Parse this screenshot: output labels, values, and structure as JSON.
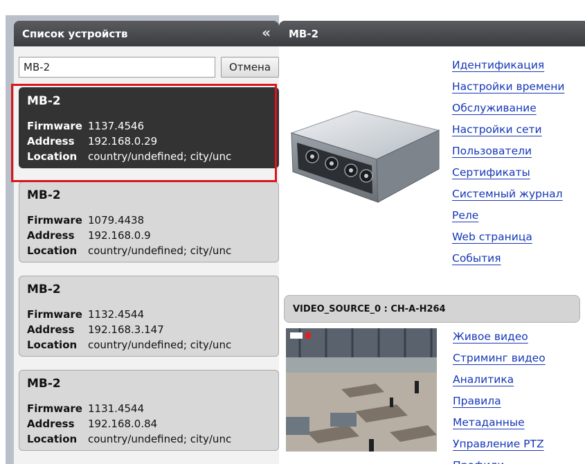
{
  "device_list": {
    "title": "Список устройств",
    "collapse_icon": "double-chevron-left-icon",
    "search": {
      "value": "MB-2",
      "placeholder": ""
    },
    "cancel_label": "Отмена",
    "field_labels": {
      "firmware": "Firmware",
      "address": "Address",
      "location": "Location"
    },
    "devices": [
      {
        "name": "MB-2",
        "firmware": "1137.4546",
        "address": "192.168.0.29",
        "location": "country/undefined; city/unc",
        "selected": true
      },
      {
        "name": "MB-2",
        "firmware": "1079.4438",
        "address": "192.168.0.9",
        "location": "country/undefined; city/unc",
        "selected": false
      },
      {
        "name": "MB-2",
        "firmware": "1132.4544",
        "address": "192.168.3.147",
        "location": "country/undefined; city/unc",
        "selected": false
      },
      {
        "name": "MB-2",
        "firmware": "1131.4544",
        "address": "192.168.0.84",
        "location": "country/undefined; city/unc",
        "selected": false
      }
    ]
  },
  "device_panel": {
    "title": "MB-2",
    "menu": [
      "Идентификация",
      "Настройки времени",
      "Обслуживание",
      "Настройки сети",
      "Пользователи",
      "Сертификаты",
      "Системный журнал",
      "Реле",
      "Web страница",
      "События"
    ],
    "video_source": {
      "label": "VIDEO_SOURCE_0 : CH-A-H264",
      "menu": [
        "Живое видео",
        "Стриминг видео",
        "Аналитика",
        "Правила",
        "Метаданные",
        "Управление PTZ",
        "Профили"
      ]
    }
  },
  "colors": {
    "header_bg": "#3b3c3f",
    "selected_card_bg": "#333333",
    "card_bg": "#d8d8d8",
    "highlight_border": "#d9161c",
    "link": "#1537b8",
    "panel_frame": "#b9c0c9"
  }
}
